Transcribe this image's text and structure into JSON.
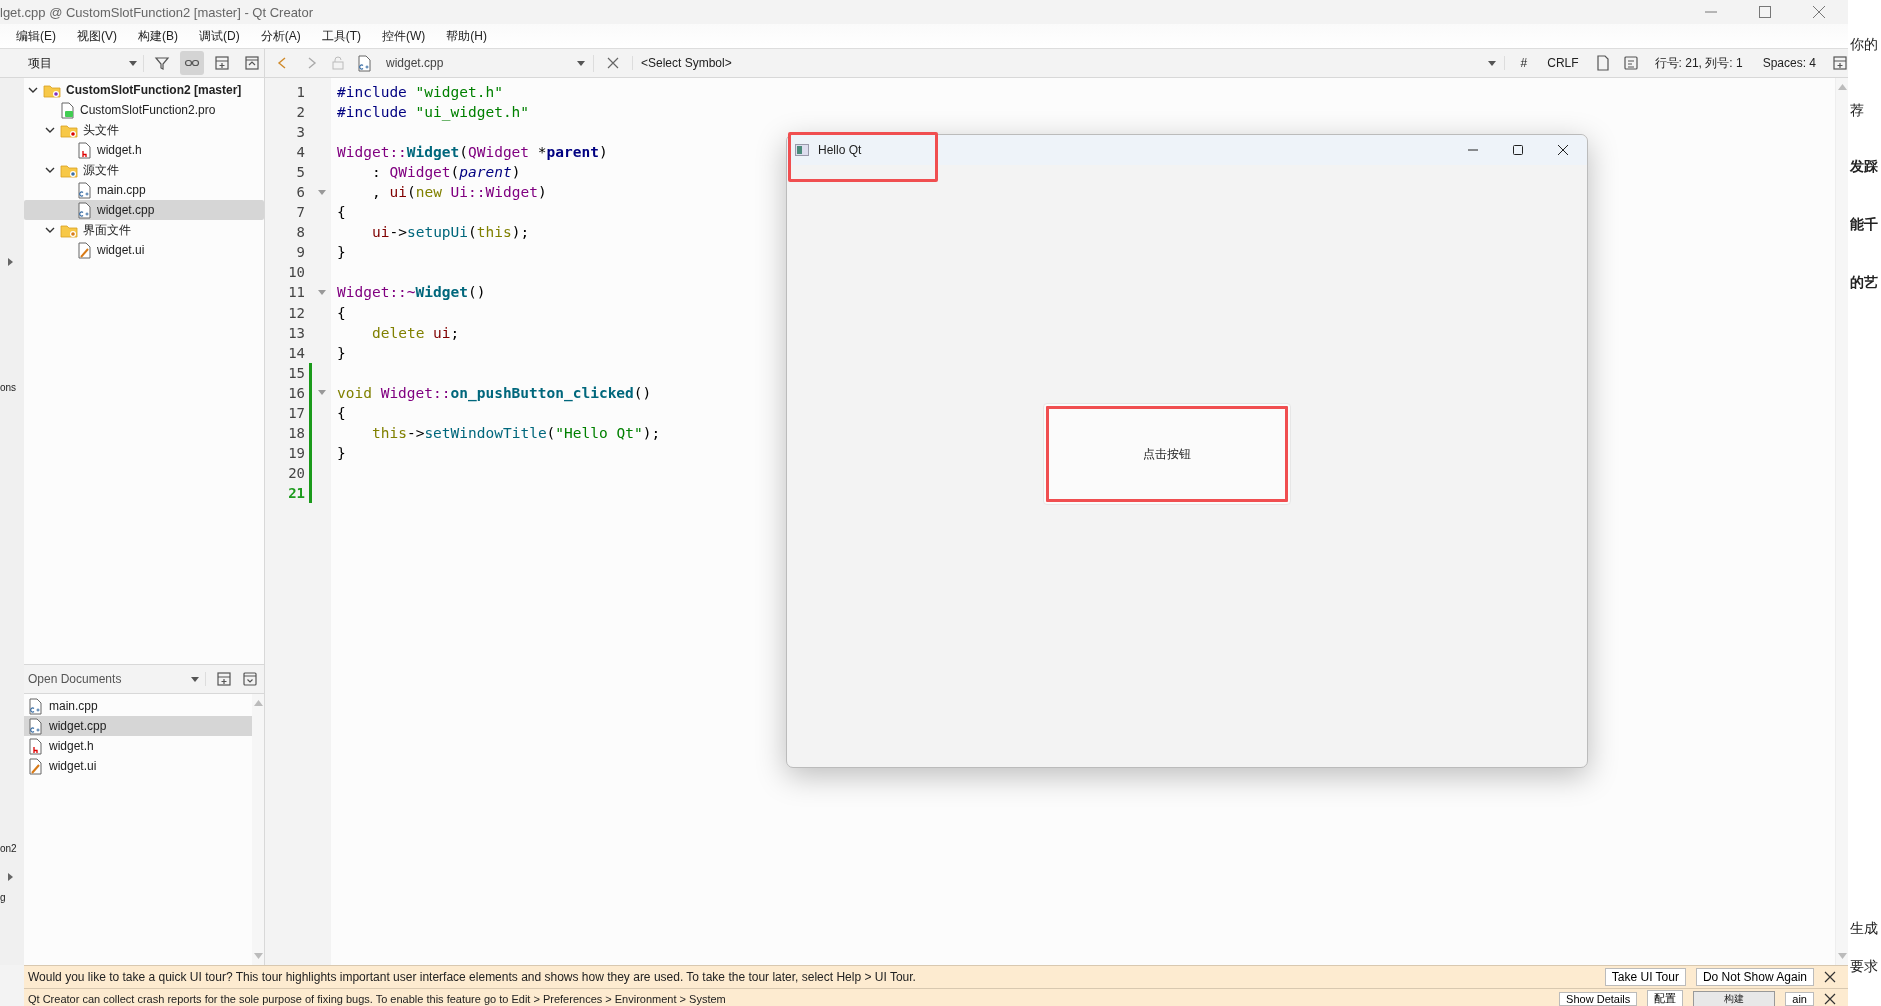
{
  "window": {
    "title": "lget.cpp @ CustomSlotFunction2 [master] - Qt Creator"
  },
  "menu": [
    "编辑(E)",
    "视图(V)",
    "构建(B)",
    "调试(D)",
    "分析(A)",
    "工具(T)",
    "控件(W)",
    "帮助(H)"
  ],
  "projects_toolbar": {
    "view": "项目",
    "tools": [
      {
        "kind": "filter",
        "selected": false
      },
      {
        "kind": "link",
        "selected": true
      },
      {
        "kind": "split",
        "selected": false
      },
      {
        "kind": "collapse",
        "selected": false
      }
    ]
  },
  "editor_toolbar": {
    "file": "widget.cpp",
    "symbol": "<Select Symbol>",
    "encoding_mark": "#",
    "line_ending": "CRLF",
    "position": "行号: 21, 列号: 1",
    "indent": "Spaces: 4"
  },
  "project_tree": [
    {
      "label": "CustomSlotFunction2 [master]",
      "kind": "project",
      "expanded": true,
      "selected": false,
      "children": [
        {
          "label": "CustomSlotFunction2.pro",
          "kind": "pro",
          "selected": false
        },
        {
          "label": "头文件",
          "kind": "folder-h",
          "expanded": true,
          "selected": false,
          "children": [
            {
              "label": "widget.h",
              "kind": "header",
              "selected": false
            }
          ]
        },
        {
          "label": "源文件",
          "kind": "folder-cpp",
          "expanded": true,
          "selected": false,
          "children": [
            {
              "label": "main.cpp",
              "kind": "cpp",
              "selected": false
            },
            {
              "label": "widget.cpp",
              "kind": "cpp",
              "selected": true
            }
          ]
        },
        {
          "label": "界面文件",
          "kind": "folder-ui",
          "expanded": true,
          "selected": false,
          "children": [
            {
              "label": "widget.ui",
              "kind": "ui",
              "selected": false
            }
          ]
        }
      ]
    }
  ],
  "open_documents": {
    "title": "Open Documents",
    "items": [
      {
        "label": "main.cpp",
        "kind": "cpp",
        "selected": false
      },
      {
        "label": "widget.cpp",
        "kind": "cpp",
        "selected": true
      },
      {
        "label": "widget.h",
        "kind": "header",
        "selected": false
      },
      {
        "label": "widget.ui",
        "kind": "ui",
        "selected": false
      }
    ]
  },
  "code": {
    "lines": [
      {
        "number": "1",
        "fold": false,
        "changed": false,
        "current": false,
        "tokens": [
          {
            "kind": "pp",
            "text": "#include "
          },
          {
            "kind": "str",
            "text": "\"widget.h\""
          }
        ]
      },
      {
        "number": "2",
        "fold": false,
        "changed": false,
        "current": false,
        "tokens": [
          {
            "kind": "pp",
            "text": "#include "
          },
          {
            "kind": "str",
            "text": "\"ui_widget.h\""
          }
        ]
      },
      {
        "number": "3",
        "fold": false,
        "changed": false,
        "current": false
      },
      {
        "number": "4",
        "fold": false,
        "changed": false,
        "current": false,
        "tokens": [
          {
            "kind": "type",
            "text": "Widget::"
          },
          {
            "kind": "decl",
            "text": "Widget"
          },
          {
            "kind": "plain",
            "text": "("
          },
          {
            "kind": "type",
            "text": "QWidget"
          },
          {
            "kind": "plain",
            "text": " *"
          },
          {
            "kind": "param",
            "text": "parent"
          },
          {
            "kind": "plain",
            "text": ")"
          }
        ]
      },
      {
        "number": "5",
        "fold": false,
        "changed": false,
        "current": false,
        "indented": true,
        "tokens": [
          {
            "kind": "plain",
            "text": ": "
          },
          {
            "kind": "type",
            "text": "QWidget"
          },
          {
            "kind": "plain",
            "text": "("
          },
          {
            "kind": "paramuse",
            "text": "parent"
          },
          {
            "kind": "plain",
            "text": ")"
          }
        ]
      },
      {
        "number": "6",
        "fold": true,
        "changed": false,
        "current": false,
        "indented": true,
        "tokens": [
          {
            "kind": "plain",
            "text": ", "
          },
          {
            "kind": "field",
            "text": "ui"
          },
          {
            "kind": "plain",
            "text": "("
          },
          {
            "kind": "kw",
            "text": "new "
          },
          {
            "kind": "type",
            "text": "Ui::Widget"
          },
          {
            "kind": "plain",
            "text": ")"
          }
        ]
      },
      {
        "number": "7",
        "fold": false,
        "changed": false,
        "current": false,
        "tokens": [
          {
            "kind": "plain",
            "text": "{"
          }
        ]
      },
      {
        "number": "8",
        "fold": false,
        "changed": false,
        "current": false,
        "indented": true,
        "tokens": [
          {
            "kind": "field",
            "text": "ui"
          },
          {
            "kind": "plain",
            "text": "->"
          },
          {
            "kind": "fn",
            "text": "setupUi"
          },
          {
            "kind": "plain",
            "text": "("
          },
          {
            "kind": "kw",
            "text": "this"
          },
          {
            "kind": "plain",
            "text": ");"
          }
        ]
      },
      {
        "number": "9",
        "fold": false,
        "changed": false,
        "current": false,
        "tokens": [
          {
            "kind": "plain",
            "text": "}"
          }
        ]
      },
      {
        "number": "10",
        "fold": false,
        "changed": false,
        "current": false
      },
      {
        "number": "11",
        "fold": true,
        "changed": false,
        "current": false,
        "tokens": [
          {
            "kind": "type",
            "text": "Widget::~"
          },
          {
            "kind": "decl",
            "text": "Widget"
          },
          {
            "kind": "plain",
            "text": "()"
          }
        ]
      },
      {
        "number": "12",
        "fold": false,
        "changed": false,
        "current": false,
        "tokens": [
          {
            "kind": "plain",
            "text": "{"
          }
        ]
      },
      {
        "number": "13",
        "fold": false,
        "changed": false,
        "current": false,
        "indented": true,
        "tokens": [
          {
            "kind": "kw",
            "text": "delete "
          },
          {
            "kind": "field",
            "text": "ui"
          },
          {
            "kind": "plain",
            "text": ";"
          }
        ]
      },
      {
        "number": "14",
        "fold": false,
        "changed": false,
        "current": false,
        "tokens": [
          {
            "kind": "plain",
            "text": "}"
          }
        ]
      },
      {
        "number": "15",
        "fold": false,
        "changed": true,
        "current": false
      },
      {
        "number": "16",
        "fold": true,
        "changed": true,
        "current": false,
        "tokens": [
          {
            "kind": "kw",
            "text": "void "
          },
          {
            "kind": "type",
            "text": "Widget::"
          },
          {
            "kind": "decl",
            "text": "on_pushButton_clicked"
          },
          {
            "kind": "plain",
            "text": "()"
          }
        ]
      },
      {
        "number": "17",
        "fold": false,
        "changed": true,
        "current": false,
        "tokens": [
          {
            "kind": "plain",
            "text": "{"
          }
        ]
      },
      {
        "number": "18",
        "fold": false,
        "changed": true,
        "current": false,
        "indented": true,
        "tokens": [
          {
            "kind": "kw",
            "text": "this"
          },
          {
            "kind": "plain",
            "text": "->"
          },
          {
            "kind": "fn",
            "text": "setWindowTitle"
          },
          {
            "kind": "plain",
            "text": "("
          },
          {
            "kind": "str",
            "text": "\"Hello Qt\""
          },
          {
            "kind": "plain",
            "text": ");"
          }
        ]
      },
      {
        "number": "19",
        "fold": false,
        "changed": true,
        "current": false,
        "tokens": [
          {
            "kind": "plain",
            "text": "}"
          }
        ]
      },
      {
        "number": "20",
        "fold": false,
        "changed": true,
        "current": false
      },
      {
        "number": "21",
        "fold": false,
        "changed": true,
        "current": true
      }
    ]
  },
  "app_window": {
    "title": "Hello Qt",
    "title_highlighted": true,
    "button": {
      "label": "点击按钮",
      "highlighted": true
    }
  },
  "notifications": [
    {
      "message": "Would you like to take a quick UI tour? This tour highlights important user interface elements and shows how they are used. To take the tour later, select Help > UI Tour.",
      "buttons": [
        "Take UI Tour",
        "Do Not Show Again"
      ]
    },
    {
      "message": "Qt Creator can collect crash reports for the sole purpose of fixing bugs. To enable this feature go to Edit > Preferences > Environment > System",
      "buttons": [
        "Show Details",
        "配置"
      ],
      "tooltip": "构建",
      "tail": "ain"
    }
  ],
  "left_fragments": [
    "ons",
    "on2",
    "g"
  ],
  "right_fragments": [
    "你的",
    "荐",
    "发踩",
    "能千",
    "的艺",
    "生成",
    "要求"
  ]
}
